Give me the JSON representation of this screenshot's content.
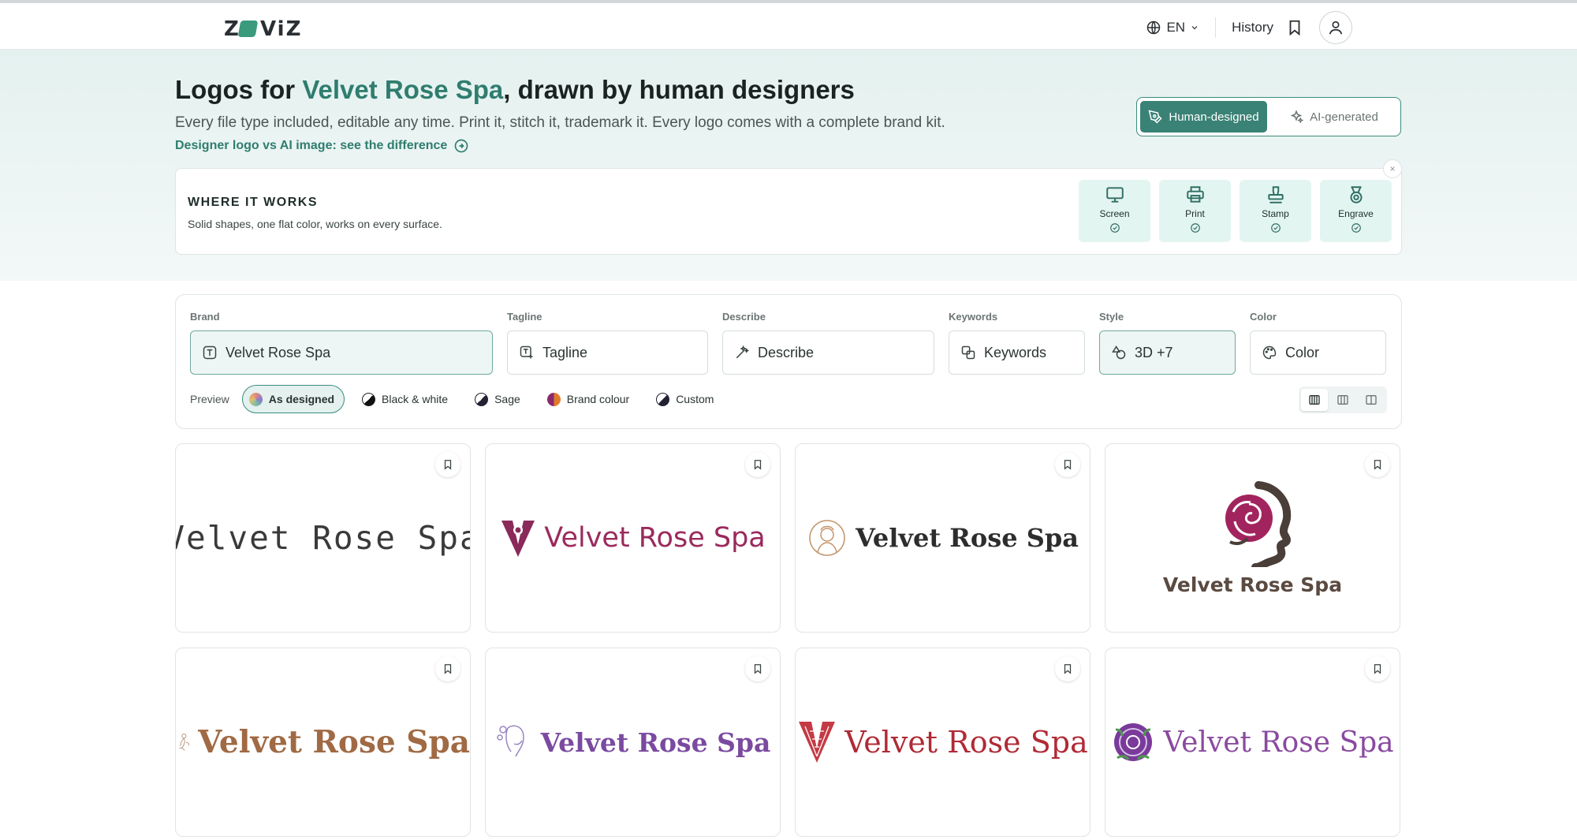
{
  "header": {
    "logo_text": "ZOVIZ",
    "language": "EN",
    "history": "History"
  },
  "hero": {
    "title_prefix": "Logos for ",
    "brand": "Velvet Rose Spa",
    "title_suffix": ", drawn by human designers",
    "subtitle": "Every file type included, editable any time. Print it, stitch it, trademark it. Every logo comes with a complete brand kit.",
    "link": "Designer logo vs AI image: see the difference",
    "toggle": {
      "human": "Human-designed",
      "ai": "AI-generated",
      "selected": "human"
    }
  },
  "works": {
    "title": "WHERE IT WORKS",
    "subtitle": "Solid shapes, one flat color, works on every surface.",
    "close": "×",
    "surfaces": [
      {
        "label": "Screen",
        "icon": "monitor-icon"
      },
      {
        "label": "Print",
        "icon": "printer-icon"
      },
      {
        "label": "Stamp",
        "icon": "stamp-icon"
      },
      {
        "label": "Engrave",
        "icon": "medal-icon"
      }
    ]
  },
  "filters": {
    "brand": {
      "label": "Brand",
      "value": "Velvet Rose Spa"
    },
    "tagline": {
      "label": "Tagline",
      "placeholder": "Tagline"
    },
    "describe": {
      "label": "Describe",
      "placeholder": "Describe"
    },
    "keywords": {
      "label": "Keywords",
      "placeholder": "Keywords"
    },
    "style": {
      "label": "Style",
      "value": "3D +7"
    },
    "color": {
      "label": "Color",
      "placeholder": "Color"
    },
    "preview": {
      "label": "Preview",
      "options": [
        "As designed",
        "Black & white",
        "Sage",
        "Brand colour",
        "Custom"
      ],
      "selected": "As designed"
    }
  },
  "logos": [
    {
      "text": "Velvet Rose Spa",
      "color": "#3a3a3a"
    },
    {
      "text": "Velvet Rose Spa",
      "color": "#9a2a5c"
    },
    {
      "text": "Velvet Rose Spa",
      "color": "#2d2d2d"
    },
    {
      "text": "Velvet Rose Spa",
      "color": "#5a4a40"
    },
    {
      "text": "Velvet Rose Spa",
      "color": "#a06a44"
    },
    {
      "text": "Velvet Rose Spa",
      "color": "#7a4aa0"
    },
    {
      "text": "Velvet Rose Spa",
      "color": "#b02a36"
    },
    {
      "text": "Velvet Rose Spa",
      "color": "#8a4aa0"
    }
  ],
  "colors": {
    "accent": "#2f7d6f",
    "accent_dark": "#3a8275",
    "hero_bg": "#e4f1ef",
    "surface_bg": "#e3f5f1"
  }
}
